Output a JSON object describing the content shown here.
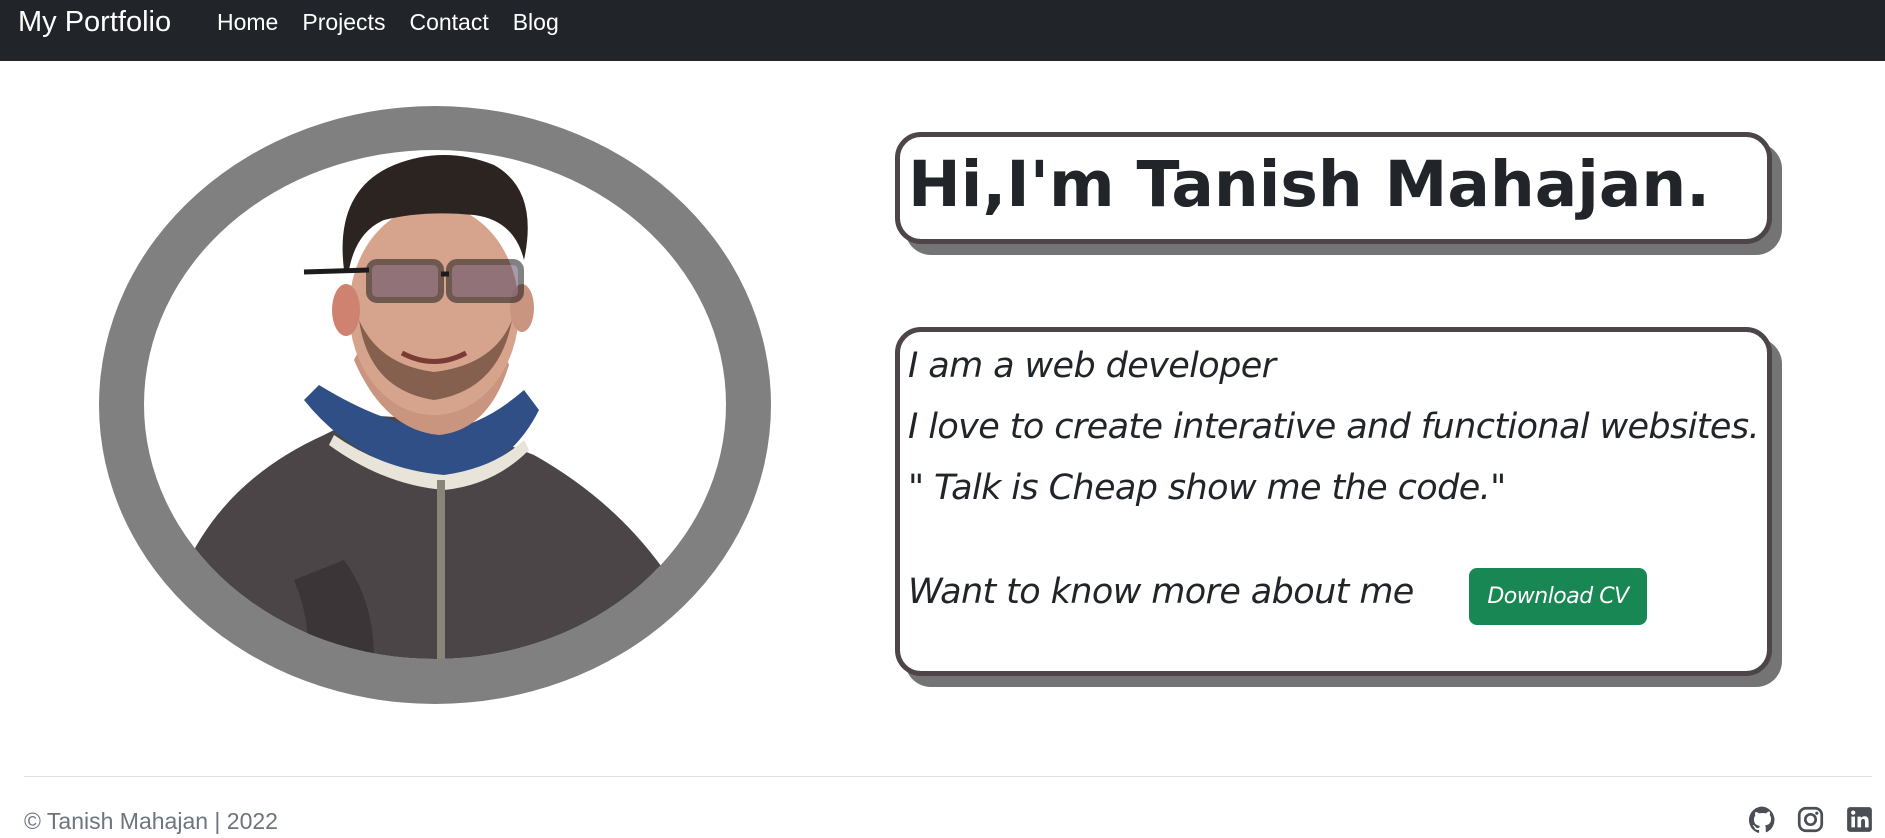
{
  "nav": {
    "brand": "My Portfolio",
    "links": [
      "Home",
      "Projects",
      "Contact",
      "Blog"
    ]
  },
  "hero": {
    "title": "Hi,I'm Tanish Mahajan.",
    "lines": [
      "I am a web developer",
      "I love to create interative and functional websites.",
      "\" Talk is Cheap show me the code.\""
    ],
    "more_prompt": "Want to know more about me",
    "download_label": "Download CV"
  },
  "footer": {
    "copyright": "© Tanish Mahajan | 2022",
    "social_icons": [
      "github-icon",
      "instagram-icon",
      "linkedin-icon"
    ]
  },
  "colors": {
    "navbar": "#212529",
    "ring": "#808080",
    "card_border": "#4d4549",
    "card_shadow": "#747474",
    "button": "#198754"
  }
}
